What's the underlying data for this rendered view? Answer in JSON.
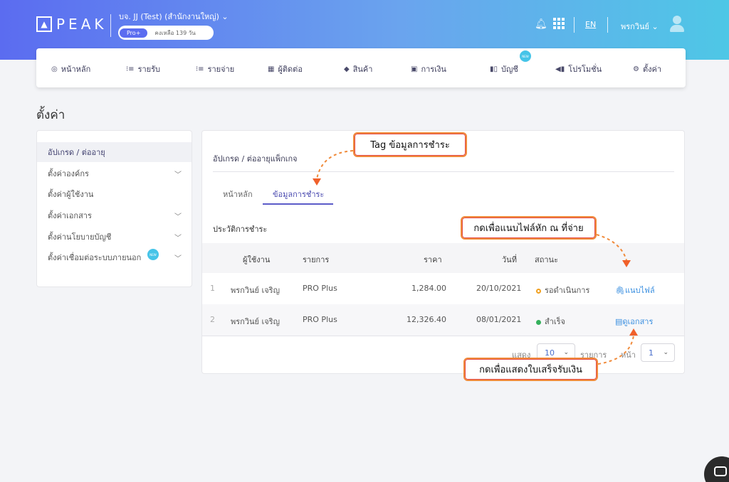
{
  "header": {
    "logo": "PEAK",
    "company": "บจ. JJ (Test) (สำนักงานใหญ่)",
    "plan_badge": "Pro+",
    "days_left": "คงเหลือ 139 วัน",
    "lang": "EN",
    "user_name": "พรกวินย์"
  },
  "nav": {
    "items": [
      {
        "label": "หน้าหลัก",
        "icon": "dashboard-icon"
      },
      {
        "label": "รายรับ",
        "icon": "income-icon"
      },
      {
        "label": "รายจ่าย",
        "icon": "expense-icon"
      },
      {
        "label": "ผู้ติดต่อ",
        "icon": "contact-icon"
      },
      {
        "label": "สินค้า",
        "icon": "product-icon"
      },
      {
        "label": "การเงิน",
        "icon": "money-icon"
      },
      {
        "label": "บัญชี",
        "icon": "book-icon"
      },
      {
        "label": "โปรโมชั่น",
        "icon": "megaphone-icon"
      },
      {
        "label": "ตั้งค่า",
        "icon": "gear-icon"
      }
    ],
    "new_badge": "NEW"
  },
  "page_title": "ตั้งค่า",
  "sidebar": {
    "items": [
      {
        "label": "อัปเกรด / ต่ออายุ"
      },
      {
        "label": "ตั้งค่าองค์กร"
      },
      {
        "label": "ตั้งค่าผู้ใช้งาน"
      },
      {
        "label": "ตั้งค่าเอกสาร"
      },
      {
        "label": "ตั้งค่านโยบายบัญชี"
      },
      {
        "label": "ตั้งค่าเชื่อมต่อระบบภายนอก"
      }
    ],
    "new_badge": "NEW"
  },
  "main": {
    "section_title": "อัปเกรด / ต่ออายุแพ็กเกจ",
    "tabs": [
      "หน้าหลัก",
      "ข้อมูลการชำระ"
    ],
    "history_title": "ประวัติการชำระ",
    "columns": [
      "ผู้ใช้งาน",
      "รายการ",
      "ราคา",
      "วันที่",
      "สถานะ"
    ],
    "rows": [
      {
        "no": "1",
        "user": "พรกวินย์ เจริญ",
        "item": "PRO Plus",
        "price": "1,284.00",
        "date": "20/10/2021",
        "status": "รอดำเนินการ",
        "action": "แนบไฟล์"
      },
      {
        "no": "2",
        "user": "พรกวินย์ เจริญ",
        "item": "PRO Plus",
        "price": "12,326.40",
        "date": "08/01/2021",
        "status": "สำเร็จ",
        "action": "ดูเอกสาร"
      }
    ],
    "pager": {
      "show_label": "แสดง",
      "per_page": "10",
      "items_label": "รายการ",
      "page_label": "หน้า",
      "page": "1"
    }
  },
  "callouts": {
    "tag": "Tag ข้อมูลการชำระ",
    "attach": "กดเพื่อแนบไฟล์หัก ณ ที่จ่าย",
    "receipt": "กดเพื่อแสดงใบเสร็จรับเงิน"
  },
  "colors": {
    "accent": "#5b6cf0",
    "callout_border": "#f08a3a",
    "success": "#35b05c",
    "pending": "#f0a020",
    "link": "#3a8fe0"
  }
}
